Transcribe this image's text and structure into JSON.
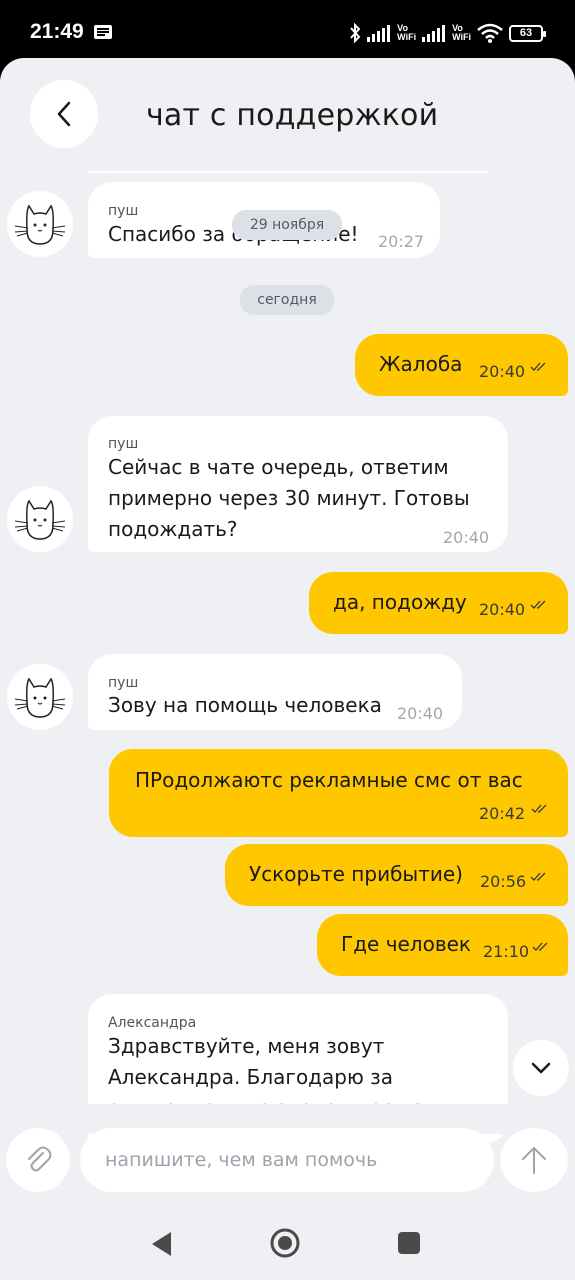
{
  "status_bar": {
    "time": "21:49",
    "vowifi_1": "Vo\nWiFi",
    "vowifi_2": "Vo\nWiFi",
    "battery": "63"
  },
  "header": {
    "title": "чат с поддержкой"
  },
  "date_pills": {
    "floating": "29 ноября",
    "today": "сегодня"
  },
  "messages": [
    {
      "direction": "in",
      "sender": "пуш",
      "text": "Спасибо за обращение!",
      "time": "20:27"
    },
    {
      "direction": "out",
      "text": "Жалоба",
      "time": "20:40",
      "status": "read"
    },
    {
      "direction": "in",
      "sender": "пуш",
      "lines": [
        "Сейчас в чате очередь, ответим",
        "примерно через 30 минут. Готовы",
        "подождать?"
      ],
      "time": "20:40"
    },
    {
      "direction": "out",
      "text": "да, подожду",
      "time": "20:40",
      "status": "read"
    },
    {
      "direction": "in",
      "sender": "пуш",
      "text": "Зову на помощь человека",
      "time": "20:40"
    },
    {
      "direction": "out",
      "text": "ПРодолжаютс рекламные смс от вас",
      "time": "20:42",
      "status": "read"
    },
    {
      "direction": "out",
      "text": "Ускорьте прибытие)",
      "time": "20:56",
      "status": "read"
    },
    {
      "direction": "out",
      "text": "Где человек",
      "time": "21:10",
      "status": "read"
    },
    {
      "direction": "in",
      "sender": "Александра",
      "lines": [
        "Здравствуйте, меня зовут",
        "Александра. Благодарю за",
        "ожидание, уже знакомлюсь с"
      ]
    }
  ],
  "composer": {
    "placeholder": "напишите, чем вам помочь",
    "value": ""
  },
  "icons": {
    "back": "chevron-left-icon",
    "avatar": "cat-icon",
    "attach": "paperclip-icon",
    "send": "arrow-up-icon",
    "scroll_down": "chevron-down-icon"
  },
  "colors": {
    "outgoing_bubble": "#ffc700",
    "incoming_bubble": "#ffffff",
    "background": "#eff0f3",
    "status_bar": "#000000"
  }
}
